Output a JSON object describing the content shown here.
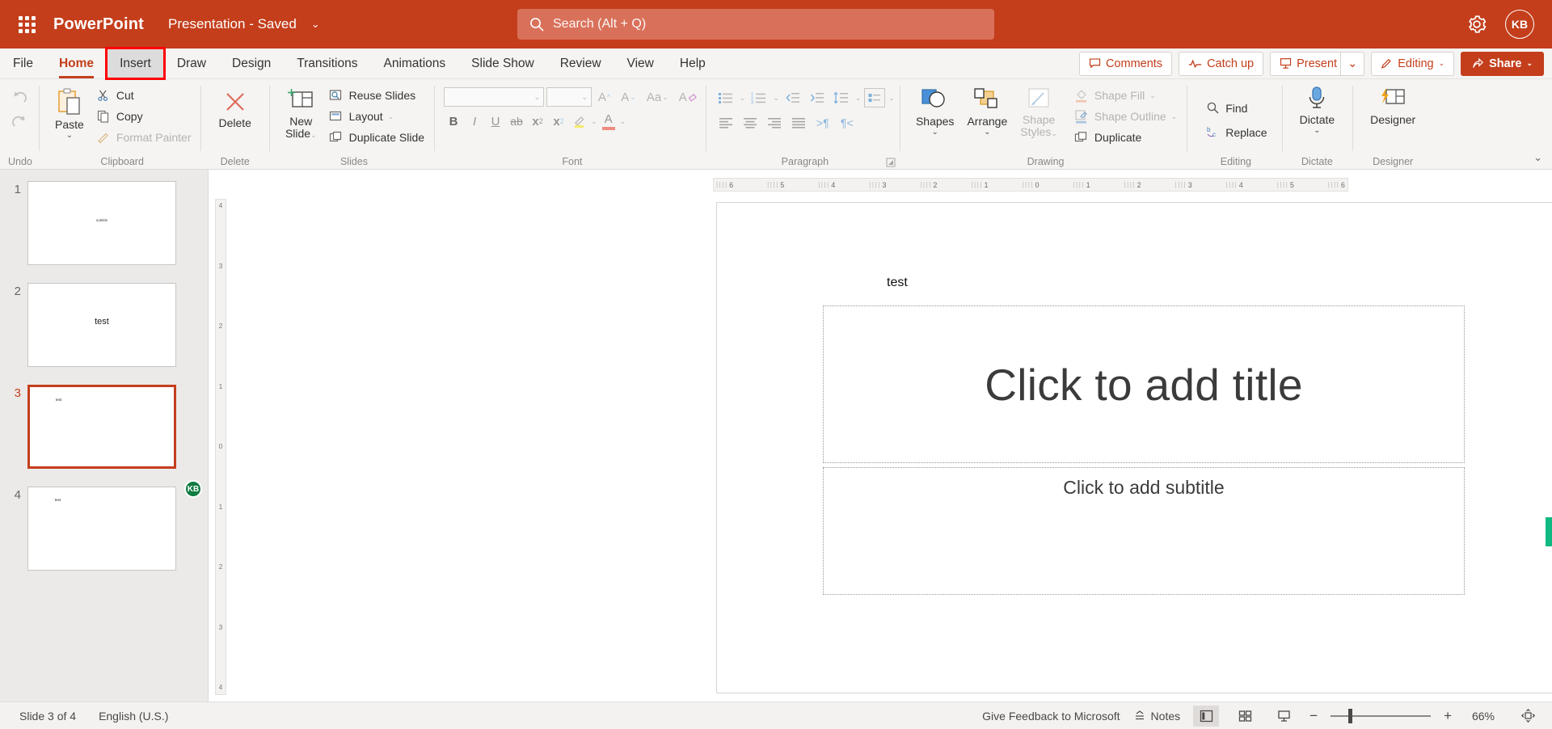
{
  "titlebar": {
    "waffle_name": "app-launcher",
    "brand": "PowerPoint",
    "document_name": "Presentation  -  Saved",
    "caret": "⌄",
    "search_placeholder": "Search (Alt + Q)",
    "search_value": "",
    "avatar_initials": "KB",
    "brand_color": "#c43e1c"
  },
  "tabs": [
    {
      "label": "File",
      "state": "normal"
    },
    {
      "label": "Home",
      "state": "active"
    },
    {
      "label": "Insert",
      "state": "highlighted"
    },
    {
      "label": "Draw",
      "state": "normal"
    },
    {
      "label": "Design",
      "state": "normal"
    },
    {
      "label": "Transitions",
      "state": "normal"
    },
    {
      "label": "Animations",
      "state": "normal"
    },
    {
      "label": "Slide Show",
      "state": "normal"
    },
    {
      "label": "Review",
      "state": "normal"
    },
    {
      "label": "View",
      "state": "normal"
    },
    {
      "label": "Help",
      "state": "normal"
    }
  ],
  "tabbar_actions": {
    "comments": "Comments",
    "catch_up": "Catch up",
    "present": "Present",
    "present_caret": "⌄",
    "editing": "Editing",
    "editing_caret": "⌄",
    "share": "Share",
    "share_caret": "⌄"
  },
  "ribbon": {
    "undo": {
      "label": "Undo",
      "undo_icon": "undo-arrow-icon",
      "redo_icon": "redo-arrow-icon"
    },
    "clipboard": {
      "label": "Clipboard",
      "paste": "Paste",
      "paste_caret": "⌄",
      "cut": "Cut",
      "copy": "Copy",
      "format_painter": "Format Painter"
    },
    "delete": {
      "label": "Delete",
      "button": "Delete"
    },
    "slides": {
      "label": "Slides",
      "new_slide_line1": "New",
      "new_slide_line2": "Slide",
      "new_slide_caret": "⌄",
      "reuse_slides": "Reuse Slides",
      "layout": "Layout",
      "layout_caret": "⌄",
      "duplicate_slide": "Duplicate Slide"
    },
    "font": {
      "label": "Font",
      "font_name_value": "",
      "font_size_value": "",
      "grow_font": "A",
      "shrink_font": "A",
      "change_case": "Aa",
      "clear_formatting": "A",
      "bold": "B",
      "italic": "I",
      "underline": "U",
      "strikethrough": "ab",
      "subscript": "x",
      "superscript": "x",
      "highlight": "highlight-icon",
      "font_color": "A"
    },
    "paragraph": {
      "label": "Paragraph",
      "bullets": "bullet-list-icon",
      "numbering": "numbered-list-icon",
      "decrease_indent": "decrease-indent-icon",
      "increase_indent": "increase-indent-icon",
      "line_spacing": "line-spacing-icon",
      "text_direction": "text-direction-icon",
      "align_left": "align-left-icon",
      "align_center": "align-center-icon",
      "align_right": "align-right-icon",
      "justify": "justify-icon",
      "ltr": ">¶",
      "rtl": "¶<"
    },
    "drawing": {
      "label": "Drawing",
      "shapes": "Shapes",
      "shapes_caret": "⌄",
      "arrange": "Arrange",
      "arrange_caret": "⌄",
      "shape_styles_l1": "Shape",
      "shape_styles_l2": "Styles",
      "shape_styles_caret": "⌄",
      "shape_fill": "Shape Fill",
      "shape_fill_caret": "⌄",
      "shape_outline": "Shape Outline",
      "shape_outline_caret": "⌄",
      "duplicate": "Duplicate"
    },
    "editing": {
      "label": "Editing",
      "find": "Find",
      "replace": "Replace"
    },
    "dictate": {
      "label": "Dictate",
      "button": "Dictate",
      "caret": "⌄"
    },
    "designer": {
      "label": "Designer",
      "button": "Designer"
    },
    "collapse_caret": "⌄"
  },
  "thumbnails": [
    {
      "number": "1",
      "kind": "subtitle",
      "text": "subtitle",
      "selected": false,
      "presence": ""
    },
    {
      "number": "2",
      "kind": "center",
      "text": "test",
      "selected": false,
      "presence": ""
    },
    {
      "number": "3",
      "kind": "topleft",
      "text": "test",
      "selected": true,
      "presence": ""
    },
    {
      "number": "4",
      "kind": "topleft",
      "text": "test",
      "selected": false,
      "presence": "KB"
    }
  ],
  "ruler": {
    "horizontal": [
      "6",
      "5",
      "4",
      "3",
      "2",
      "1",
      "0",
      "1",
      "2",
      "3",
      "4",
      "5",
      "6"
    ],
    "vertical": [
      "4",
      "3",
      "2",
      "1",
      "0",
      "1",
      "2",
      "3",
      "4"
    ]
  },
  "slide": {
    "text_box": "test",
    "title_placeholder": "Click to add title",
    "subtitle_placeholder": "Click to add subtitle"
  },
  "statusbar": {
    "slide_counter": "Slide 3 of 4",
    "language": "English (U.S.)",
    "feedback": "Give Feedback to Microsoft",
    "notes": "Notes",
    "view_normal": "normal-view-icon",
    "view_sorter": "slide-sorter-icon",
    "view_reading": "reading-view-icon",
    "zoom_out": "−",
    "zoom_in": "+",
    "zoom_value": "66%",
    "fit_slide": "fit-to-window-icon"
  }
}
